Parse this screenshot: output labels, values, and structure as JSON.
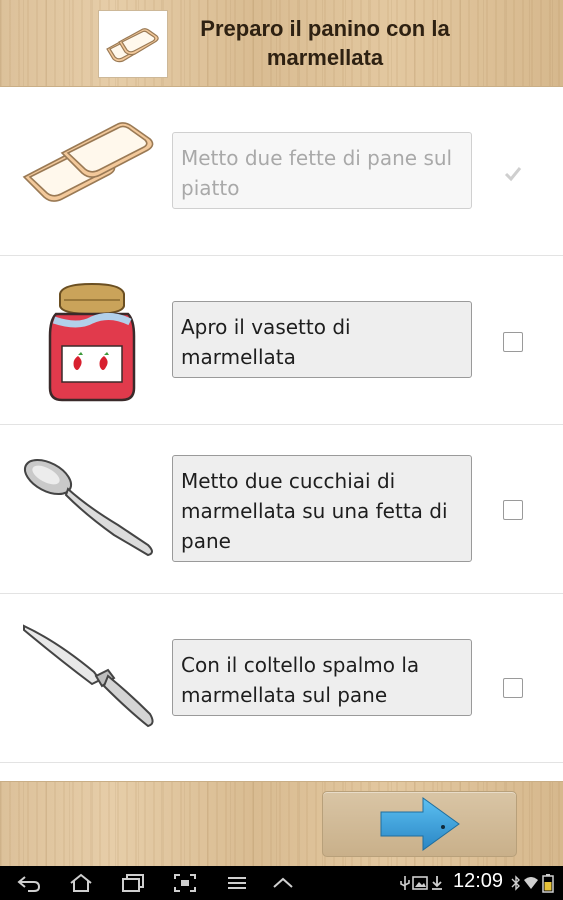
{
  "header": {
    "title": "Preparo il panino con la marmellata",
    "thumbnail_icon": "bread-slices-icon"
  },
  "steps": [
    {
      "text": "Metto due fette di pane sul piatto",
      "icon": "bread-slices-icon",
      "checked": true
    },
    {
      "text": "Apro il vasetto di marmellata",
      "icon": "jam-jar-icon",
      "checked": false
    },
    {
      "text": "Metto due cucchiai di marmellata su una fetta di pane",
      "icon": "spoon-icon",
      "checked": false
    },
    {
      "text": "Con il coltello spalmo la marmellata sul pane",
      "icon": "knife-icon",
      "checked": false
    }
  ],
  "footer": {
    "next_icon": "arrow-right-icon",
    "arrow_color": "#3a9fd8"
  },
  "status_bar": {
    "time": "12:09",
    "nav_icons": [
      "back-icon",
      "home-icon",
      "recent-apps-icon",
      "screenshot-icon",
      "menu-icon",
      "up-chevron-icon"
    ],
    "status_icons": [
      "usb-icon",
      "gallery-icon",
      "download-icon",
      "bluetooth-icon",
      "wifi-icon",
      "battery-icon"
    ]
  },
  "colors": {
    "wood": "#dcc19a",
    "checkmark": "#cfcfcf",
    "jam_red": "#e13a4c"
  }
}
